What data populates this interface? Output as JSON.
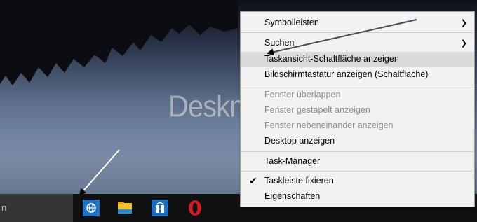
{
  "watermark": "Deskmodder.de",
  "search": {
    "text": "n"
  },
  "taskbar_icons": [
    "taskview-globe-icon",
    "file-explorer-icon",
    "store-icon",
    "opera-icon"
  ],
  "context_menu": {
    "items": [
      {
        "label": "Symbolleisten",
        "submenu": true
      },
      {
        "label": "Suchen",
        "submenu": true
      },
      {
        "label": "Taskansicht-Schaltfläche anzeigen",
        "highlighted": true
      },
      {
        "label": "Bildschirmtastatur anzeigen (Schaltfläche)"
      },
      {
        "label": "Fenster überlappen",
        "disabled": true
      },
      {
        "label": "Fenster gestapelt anzeigen",
        "disabled": true
      },
      {
        "label": "Fenster nebeneinander anzeigen",
        "disabled": true
      },
      {
        "label": "Desktop anzeigen"
      },
      {
        "label": "Task-Manager"
      },
      {
        "label": "Taskleiste fixieren",
        "checked": true
      },
      {
        "label": "Eigenschaften"
      }
    ]
  },
  "colors": {
    "menu_bg": "#f2f2f2",
    "highlight": "#dadada",
    "taskbar": "#101010",
    "disabled_text": "#8d8d8d"
  }
}
